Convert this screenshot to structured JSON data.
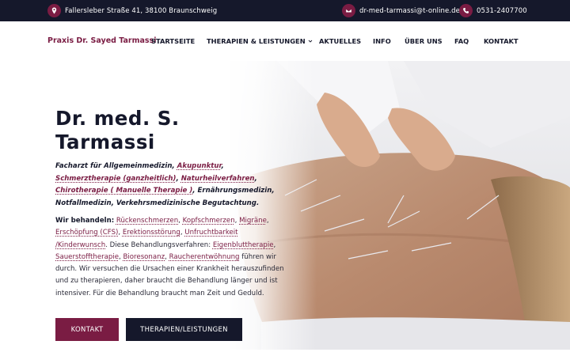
{
  "topbar": {
    "address": "Fallersleber Straße 41, 38100 Braunschweig",
    "email": "dr-med-tarmassi@t-online.de",
    "phone": "0531-2407700",
    "icons": [
      "map-pin-icon",
      "envelope-icon",
      "phone-icon"
    ],
    "accent_color": "#7a1c43",
    "background_color": "#15182b"
  },
  "nav": {
    "brand": "Praxis Dr. Sayed Tarmassi",
    "items": [
      {
        "label": "STARTSEITE"
      },
      {
        "label": "THERAPIEN & LEISTUNGEN",
        "has_dropdown": true
      },
      {
        "label": "AKTUELLES"
      },
      {
        "label": "INFO"
      },
      {
        "label": "ÜBER UNS"
      },
      {
        "label": "FAQ"
      },
      {
        "label": "KONTAKT"
      }
    ]
  },
  "hero": {
    "title": "Dr. med. S. Tarmassi",
    "lead": {
      "prefix": "Facharzt für Allgemeinmedizin, ",
      "link1": "Akupunktur",
      "sep1": ", ",
      "link2": "Schmerztherapie (ganzheitlich)",
      "sep2": ", ",
      "link3": "Naturheilverfahren",
      "sep3": ", ",
      "link4": "Chirotherapie ( Manuelle Therapie )",
      "suffix": ", Ernährungsmedizin, Notfallmedizin, Verkehrsmedizinische Begutachtung."
    },
    "body": {
      "label": "Wir behandeln:",
      "treat1": "Rückenschmerzen",
      "treat2": "Kopfschmerzen",
      "treat3": "Migräne",
      "treat4": "Erschöpfung (CFS)",
      "treat5": "Erektionsstörung",
      "treat6": "Unfruchtbarkeit /Kinderwunsch",
      "mid": ". Diese Behandlungsverfahren: ",
      "proc1": "Eigenbluttherapie",
      "proc2": "Sauerstofftherapie",
      "proc3": "Bioresonanz",
      "proc4": "Raucherentwöhnung",
      "tail": " führen wir durch. Wir versuchen die Ursachen einer Krankheit herauszufinden und zu therapieren, daher braucht die Behandlung länger und ist intensiver. Für die Behandlung braucht man Zeit und Geduld."
    },
    "buttons": {
      "kontakt": "KONTAKT",
      "therapien": "THERAPIEN/LEISTUNGEN"
    },
    "image": "acupuncture-back-photo"
  }
}
